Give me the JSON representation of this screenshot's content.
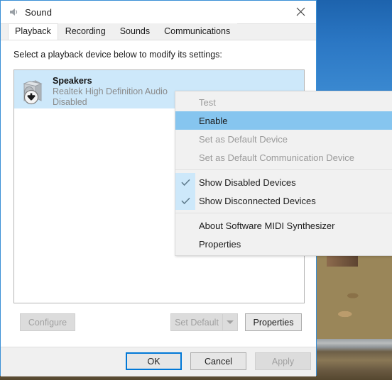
{
  "window": {
    "title": "Sound",
    "icon": "speaker-icon",
    "close_label": "✕",
    "accent_color": "#0078d7",
    "selection_color": "#cde8fa",
    "menu_highlight_color": "#86c5ef"
  },
  "tabs": [
    {
      "label": "Playback",
      "active": true
    },
    {
      "label": "Recording",
      "active": false
    },
    {
      "label": "Sounds",
      "active": false
    },
    {
      "label": "Communications",
      "active": false
    }
  ],
  "panel": {
    "instruction": "Select a playback device below to modify its settings:",
    "devices": [
      {
        "name": "Speakers",
        "description": "Realtek High Definition Audio",
        "status": "Disabled",
        "icon": "speaker-disabled-icon",
        "selected": true
      }
    ],
    "buttons": {
      "configure": {
        "label": "Configure",
        "enabled": false
      },
      "set_default": {
        "label": "Set Default",
        "enabled": false
      },
      "set_default_arrow": {
        "icon": "chevron-down-icon",
        "enabled": false
      },
      "properties": {
        "label": "Properties",
        "enabled": true
      }
    }
  },
  "footer": {
    "ok": {
      "label": "OK",
      "enabled": true,
      "focused": true
    },
    "cancel": {
      "label": "Cancel",
      "enabled": true
    },
    "apply": {
      "label": "Apply",
      "enabled": false
    }
  },
  "context_menu": {
    "items": [
      {
        "label": "Test",
        "state": "disabled",
        "checked": false
      },
      {
        "label": "Enable",
        "state": "highlighted",
        "checked": false
      },
      {
        "label": "Set as Default Device",
        "state": "disabled",
        "checked": false
      },
      {
        "label": "Set as Default Communication Device",
        "state": "disabled",
        "checked": false
      },
      {
        "separator": true
      },
      {
        "label": "Show Disabled Devices",
        "state": "normal",
        "checked": true
      },
      {
        "label": "Show Disconnected Devices",
        "state": "normal",
        "checked": true
      },
      {
        "separator": true
      },
      {
        "label": "About Software MIDI Synthesizer",
        "state": "normal",
        "checked": false
      },
      {
        "label": "Properties",
        "state": "normal",
        "checked": false
      }
    ]
  }
}
